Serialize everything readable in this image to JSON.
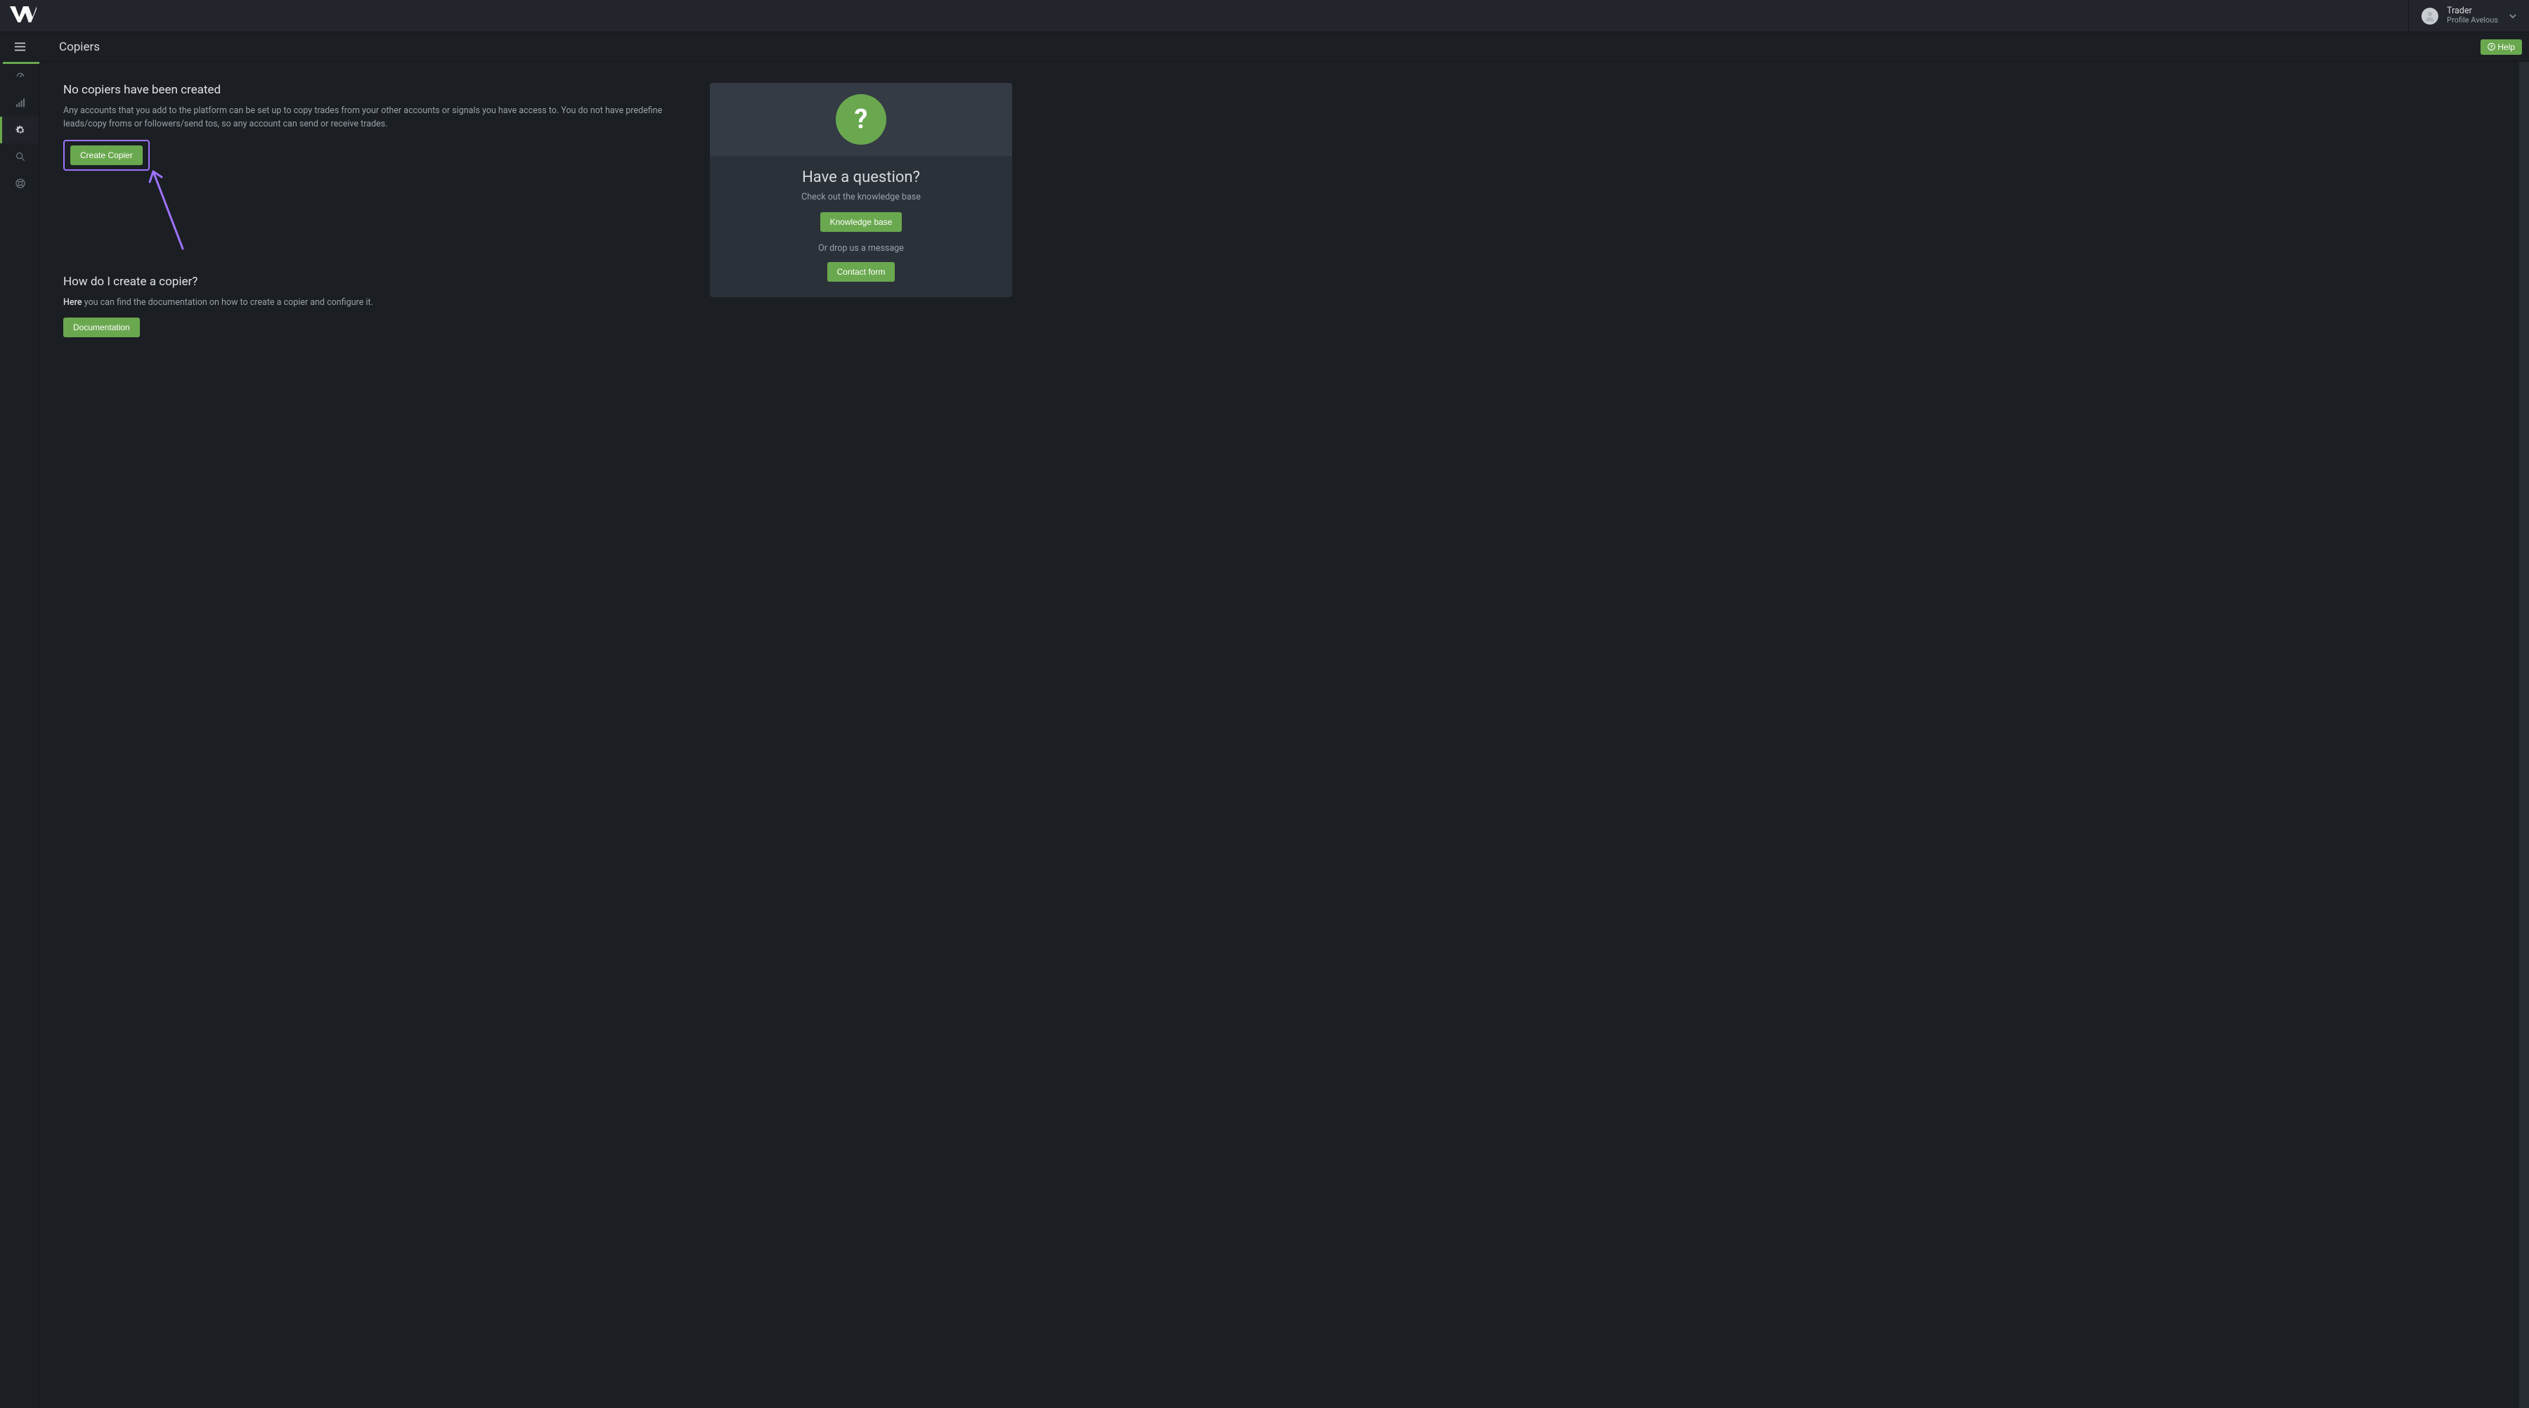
{
  "header": {
    "user_role": "Trader",
    "user_profile": "Profile Avelous"
  },
  "titlebar": {
    "page_title": "Copiers",
    "help_label": "Help"
  },
  "sidenav": {
    "items": [
      {
        "name": "dashboard"
      },
      {
        "name": "analytics"
      },
      {
        "name": "settings",
        "active": true
      },
      {
        "name": "search"
      },
      {
        "name": "support"
      }
    ]
  },
  "main": {
    "section1": {
      "heading": "No copiers have been created",
      "body": "Any accounts that you add to the platform can be set up to copy trades from your other accounts or signals you have access to. You do not have predefine leads/copy froms or followers/send tos, so any account can send or receive trades.",
      "button": "Create Copier"
    },
    "section2": {
      "heading": "How do I create a copier?",
      "here_label": "Here",
      "body_rest": " you can find the documentation on how to create a copier and configure it.",
      "button": "Documentation"
    }
  },
  "help_card": {
    "icon_text": "?",
    "heading": "Have a question?",
    "sub": "Check out the knowledge base",
    "kb_button": "Knowledge base",
    "or_text": "Or drop us a message",
    "contact_button": "Contact form"
  }
}
